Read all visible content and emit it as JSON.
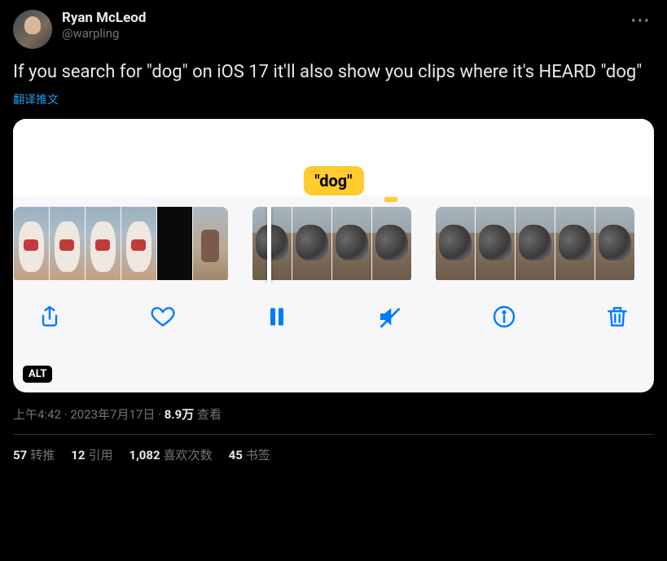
{
  "author": {
    "display_name": "Ryan McLeod",
    "handle": "@warpling"
  },
  "tweet_text": "If you search for \"dog\" on iOS 17 it'll also show you clips where it's HEARD \"dog\"",
  "translate_label": "翻译推文",
  "media": {
    "caption_pill": "\"dog\"",
    "alt_badge": "ALT"
  },
  "meta": {
    "time": "上午4:42",
    "date": "2023年7月17日",
    "views_count": "8.9万",
    "views_label": "查看"
  },
  "stats": {
    "retweets_count": "57",
    "retweets_label": "转推",
    "quotes_count": "12",
    "quotes_label": "引用",
    "likes_count": "1,082",
    "likes_label": "喜欢次数",
    "bookmarks_count": "45",
    "bookmarks_label": "书签"
  }
}
